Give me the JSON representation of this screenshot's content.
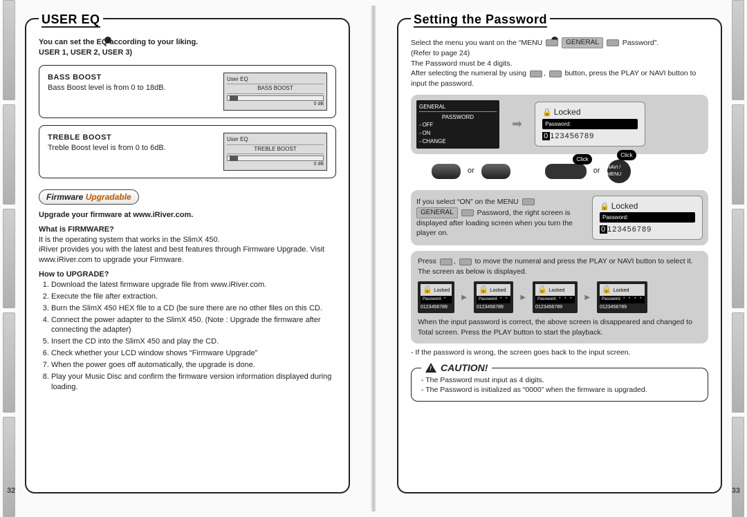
{
  "pageNumbers": {
    "left": "32",
    "right": "33"
  },
  "left": {
    "title": "USER EQ",
    "intro1": "You can set the EQ according to your liking.",
    "intro2": "USER 1, USER 2, USER 3)",
    "bass": {
      "heading": "BASS BOOST",
      "desc": "Bass Boost level is from 0 to 18dB.",
      "lcd_title": "User EQ",
      "lcd_row": "BASS BOOST",
      "lcd_val": "0",
      "lcd_unit": "dB"
    },
    "treble": {
      "heading": "TREBLE BOOST",
      "desc": "Treble Boost level is from 0 to 6dB.",
      "lcd_title": "User EQ",
      "lcd_row": "TREBLE BOOST",
      "lcd_val": "0",
      "lcd_unit": "dB"
    },
    "fw": {
      "badge_a": "Firmware",
      "badge_b": "Upgradable",
      "line1": "Upgrade your firmware at www.iRiver.com.",
      "q1": "What is FIRMWARE?",
      "ans1a": "It is the operating system that works in the SlimX 450.",
      "ans1b": "iRiver provides you with the latest and best features through Firmware Upgrade. Visit www.iRiver.com to upgrade your Firmware.",
      "q2": "How to UPGRADE?",
      "steps": [
        "Download the latest firmware upgrade file from www.iRiver.com.",
        "Execute the file after extraction.",
        "Burn the SlimX 450 HEX file to a CD (be sure there are no other files on this CD.",
        "Connect the power adapter to the SlimX 450. (Note : Upgrade the firmware after connecting the adapter)",
        "Insert the CD into the SlimX 450 and play the CD.",
        "Check whether your LCD window shows “Firmware Upgrade”",
        "When the power goes off automatically, the upgrade is done.",
        "Play your Music Disc and confirm the firmware version information displayed during loading."
      ]
    }
  },
  "right": {
    "title": "Setting the Password",
    "p1a": "Select the menu you want on the “MENU",
    "chip_general": "GENERAL",
    "chip_password": "Password”.",
    "p1b": "(Refer to page 24)",
    "p1c": "The Password must be 4 digits.",
    "p1d_a": "After selecting the numeral by using",
    "p1d_b": "button, press the PLAY or NAVI button to input the password.",
    "device": {
      "hdr": "GENERAL",
      "sub": "PASSWORD",
      "items": [
        "OFF",
        "ON",
        "CHANGE"
      ]
    },
    "arrow_icon": "arrow-right-icon",
    "lock1": {
      "title": "Locked",
      "field": "Password:",
      "digits": "0123456789",
      "hl": "0"
    },
    "or": "or",
    "click": "Click",
    "navimenu": "NAVI / MENU",
    "p2a": "If you select “ON” on the MENU",
    "p2b": "GENERAL",
    "p2c": "Password, the right screen is displayed after loading screen when you turn the player on.",
    "lock2": {
      "title": "Locked",
      "field": "Password:",
      "digits": "0123456789",
      "hl": "0"
    },
    "p3a": "Press",
    "p3b": "to move the numeral and press the PLAY or NAVI button to select it. The screen as below is displayed.",
    "minis": [
      {
        "title": "Locked",
        "field": "Password:",
        "mask": "*   ",
        "digits": "0123456789"
      },
      {
        "title": "Locked",
        "field": "Password:",
        "mask": "* *  ",
        "digits": "0123456789"
      },
      {
        "title": "Locked",
        "field": "Password:",
        "mask": "* * * ",
        "digits": "0123456789"
      },
      {
        "title": "Locked",
        "field": "Password:",
        "mask": "* * * *",
        "digits": "0123456789"
      }
    ],
    "p4": "When the input password is correct, the above screen is disappeared and changed to Total screen. Press the PLAY button to start the playback.",
    "p5": "- If the password is wrong, the screen goes back to the input screen.",
    "caution": {
      "title": "CAUTION!",
      "items": [
        "- The Password must input as 4 digits.",
        "- The Password is initialized as “0000” when the firmware is upgraded."
      ]
    }
  }
}
